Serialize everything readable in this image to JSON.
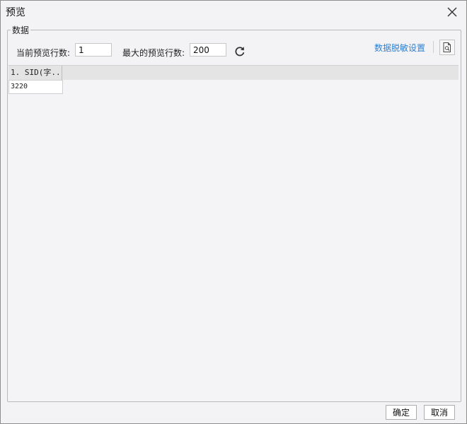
{
  "dialog": {
    "title": "预览"
  },
  "data_group": {
    "label": "数据",
    "current_rows_label": "当前预览行数:",
    "current_rows_value": "1",
    "max_rows_label": "最大的预览行数:",
    "max_rows_value": "200",
    "mask_settings_link": "数据脱敏设置"
  },
  "grid": {
    "columns": [
      "1. SID(字..."
    ],
    "rows": [
      [
        "3220"
      ]
    ]
  },
  "footer": {
    "ok_label": "确定",
    "cancel_label": "取消"
  },
  "icons": {
    "close": "close-icon",
    "refresh": "refresh-icon",
    "preview": "document-search-icon"
  },
  "colors": {
    "link": "#2f7fd0",
    "dialog_bg": "#f3f3f5",
    "grid_header_bg": "#e4e4e4"
  }
}
